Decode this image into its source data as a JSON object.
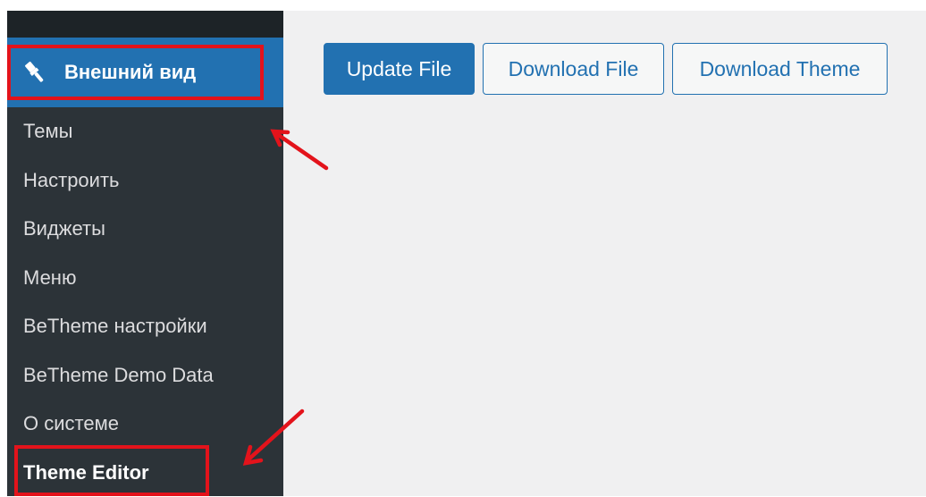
{
  "sidebar": {
    "active_menu": {
      "label": "Внешний вид",
      "icon": "paintbrush-icon"
    },
    "items": [
      {
        "label": "Темы"
      },
      {
        "label": "Настроить"
      },
      {
        "label": "Виджеты"
      },
      {
        "label": "Меню"
      },
      {
        "label": "BeTheme настройки"
      },
      {
        "label": "BeTheme Demo Data"
      },
      {
        "label": "О системе"
      },
      {
        "label": "Theme Editor",
        "current": true
      }
    ]
  },
  "toolbar": {
    "update_file": "Update File",
    "download_file": "Download File",
    "download_theme": "Download Theme"
  },
  "colors": {
    "sidebar_bg": "#2c3338",
    "sidebar_top": "#1d2327",
    "accent": "#2271b1",
    "main_bg": "#f0f0f1",
    "annotation": "#e3131b"
  }
}
